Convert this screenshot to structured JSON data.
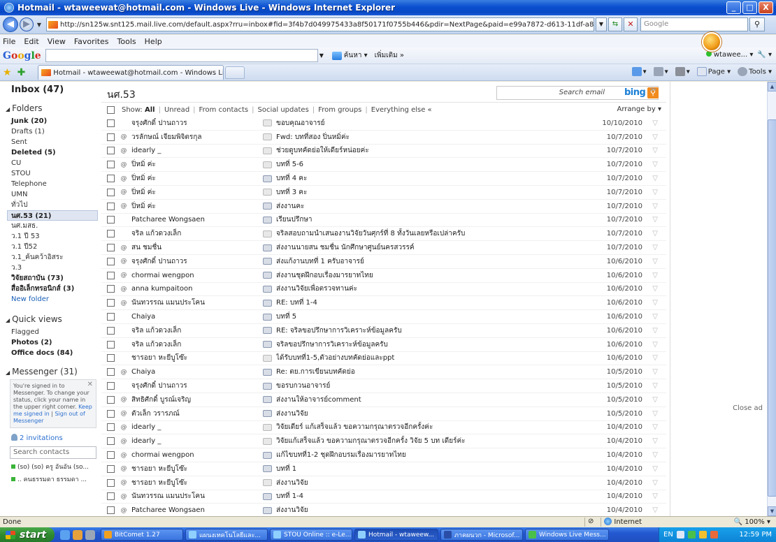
{
  "window": {
    "title": "Hotmail - wtaweewat@hotmail.com - Windows Live - Windows Internet Explorer",
    "buttons": {
      "minimize": "_",
      "maximize": "□",
      "close": "X"
    }
  },
  "address_bar": {
    "url": "http://sn125w.snt125.mail.live.com/default.aspx?rru=inbox#fid=3f4b7d049975433a8f50171f0755b446&pdir=NextPage&paid=e99a7872-d613-11df-a803-001e0bcbbd80&pad=",
    "search_placeholder": "Google"
  },
  "menu": [
    "File",
    "Edit",
    "View",
    "Favorites",
    "Tools",
    "Help"
  ],
  "google_toolbar": {
    "logo": [
      "G",
      "o",
      "o",
      "g",
      "l",
      "e"
    ],
    "search_label": "ค้นหา",
    "more_label": "เพิ่มเติม »",
    "user_label": "wtawee..."
  },
  "tab": {
    "label": "Hotmail - wtaweewat@hotmail.com - Windows Live"
  },
  "command_bar": {
    "page": "Page",
    "tools": "Tools"
  },
  "sidebar": {
    "inbox": "Inbox (47)",
    "folders_label": "Folders",
    "folders": [
      {
        "label": "Junk (20)",
        "bold": true
      },
      {
        "label": "Drafts (1)",
        "bold": false
      },
      {
        "label": "Sent",
        "bold": false
      },
      {
        "label": "Deleted (5)",
        "bold": true
      },
      {
        "label": "CU",
        "bold": false
      },
      {
        "label": "STOU",
        "bold": false
      },
      {
        "label": "Telephone",
        "bold": false
      },
      {
        "label": "UMN",
        "bold": false
      },
      {
        "label": "ทั่วไป",
        "bold": false
      },
      {
        "label": "นศ.53 (21)",
        "bold": true,
        "selected": true
      },
      {
        "label": "นศ.มสธ.",
        "bold": false
      },
      {
        "label": "ว.1 ปี 53",
        "bold": false
      },
      {
        "label": "ว.1 ปี52",
        "bold": false
      },
      {
        "label": "ว.1_ค้นคว้าอิสระ",
        "bold": false
      },
      {
        "label": "ว.3",
        "bold": false
      },
      {
        "label": "วิจัยสถาบัน (73)",
        "bold": true
      },
      {
        "label": "สื่ออิเล็กทรอนิกส์ (3)",
        "bold": true
      }
    ],
    "new_folder": "New folder",
    "quick_views_label": "Quick views",
    "quick_views": [
      {
        "label": "Flagged",
        "bold": false
      },
      {
        "label": "Photos (2)",
        "bold": true
      },
      {
        "label": "Office docs (84)",
        "bold": true
      }
    ],
    "messenger_label": "Messenger (31)",
    "messenger_note": "You're signed in to Messenger. To change your status, click your name in the upper right corner.",
    "messenger_link1": "Keep me signed in",
    "messenger_sep": "|",
    "messenger_link2": "Sign out of Messenger",
    "invitations": "2 invitations",
    "search_contacts": "Search contacts",
    "contacts": [
      "(so) (so) ครู อันอัน (so...",
      ".. คนธรรมดา ธรรมดา ..."
    ]
  },
  "list": {
    "folder_title": "นศ.53",
    "search_placeholder": "Search email",
    "bing_label": "bing",
    "filter": {
      "show": "Show:",
      "all": "All",
      "items": [
        "Unread",
        "From contacts",
        "Social updates",
        "From groups",
        "Everything else «"
      ],
      "arrange": "Arrange by ▾"
    },
    "messages": [
      {
        "at": "",
        "from": "จรุงศักดิ์ ปานถาวร",
        "subject": "ขอบคุณอาจารย์",
        "date": "10/10/2010",
        "read": false
      },
      {
        "at": "@",
        "from": "วรลักษณ์ เจียมพิจิตรกุล",
        "subject": "Fwd: บทที่สอง ปิ่นหมิ่ค่ะ",
        "date": "10/7/2010",
        "read": false
      },
      {
        "at": "@",
        "from": "idearly _",
        "subject": "ช่วยดูบทคัดย่อให้เดียร์หน่อยค่ะ",
        "date": "10/7/2010",
        "read": false
      },
      {
        "at": "@",
        "from": "ปิ่หมิ่ ค่ะ",
        "subject": "บทที่ 5-6",
        "date": "10/7/2010",
        "read": false
      },
      {
        "at": "@",
        "from": "ปิ่หมิ่ ค่ะ",
        "subject": "บทที่ 4 คะ",
        "date": "10/7/2010",
        "read": true
      },
      {
        "at": "@",
        "from": "ปิ่หมิ่ ค่ะ",
        "subject": "บทที่ 3 คะ",
        "date": "10/7/2010",
        "read": false
      },
      {
        "at": "@",
        "from": "ปิ่หมิ่ ค่ะ",
        "subject": "ส่งงานคะ",
        "date": "10/7/2010",
        "read": true
      },
      {
        "at": "",
        "from": "Patcharee Wongsaen",
        "subject": "เรียนปรึกษา",
        "date": "10/7/2010",
        "read": true
      },
      {
        "at": "",
        "from": "จริล แก้วดวงเล็ก",
        "subject": "จริลสอบถามนำเสนองานวิจัยวันศุกร์ที่ 8 ทั้งวันเลยหรือเปล่าครับ",
        "date": "10/7/2010",
        "read": false
      },
      {
        "at": "@",
        "from": "สน ชมชื่น",
        "subject": "ส่งงานนายสน ชมชื่น นักศึกษาศูนย์นครสวรรค์",
        "date": "10/7/2010",
        "read": true
      },
      {
        "at": "@",
        "from": "จรุงศักดิ์ ปานถาวร",
        "subject": "ส่งแก้งานบทที่ 1 ครับอาจารย์",
        "date": "10/6/2010",
        "read": true
      },
      {
        "at": "@",
        "from": "chormai wengpon",
        "subject": "ส่งงานชุดฝึกอบเรื่องมารยาทไทย",
        "date": "10/6/2010",
        "read": true
      },
      {
        "at": "@",
        "from": "anna kumpaitoon",
        "subject": "ส่งงานวิจัยเพื่อตรวจทานค่ะ",
        "date": "10/6/2010",
        "read": true
      },
      {
        "at": "@",
        "from": "นันทวรรณ แมนประโคน",
        "subject": "RE: บทที่ 1-4",
        "date": "10/6/2010",
        "read": true
      },
      {
        "at": "",
        "from": "Chaiya",
        "subject": "บทที่ 5",
        "date": "10/6/2010",
        "read": true
      },
      {
        "at": "",
        "from": "จริล แก้วดวงเล็ก",
        "subject": "RE: จริลขอปรึกษาการวิเคราะห์ข้อมูลครับ",
        "date": "10/6/2010",
        "read": true
      },
      {
        "at": "",
        "from": "จริล แก้วดวงเล็ก",
        "subject": "จริลขอปรึกษาการวิเคราะห์ข้อมูลครับ",
        "date": "10/6/2010",
        "read": true
      },
      {
        "at": "",
        "from": "ชารอยา หะยีบูโซ๊ะ",
        "subject": "ได้รับบทที่1-5,ตัวอย่างบทคัดย่อและppt",
        "date": "10/6/2010",
        "read": false
      },
      {
        "at": "@",
        "from": "Chaiya",
        "subject": "Re: ตย.การเขียนบทคัดย่อ",
        "date": "10/5/2010",
        "read": true
      },
      {
        "at": "",
        "from": "จรุงศักดิ์ ปานถาวร",
        "subject": "ขอรบกวนอาจารย์",
        "date": "10/5/2010",
        "read": true
      },
      {
        "at": "@",
        "from": "สิทธิศักดิ์ บูรณ์เจริญ",
        "subject": "ส่งงานให้อาจารย์comment",
        "date": "10/5/2010",
        "read": true
      },
      {
        "at": "@",
        "from": "ตัวเล็ก วรารภณ์",
        "subject": "ส่งงานวิจัย",
        "date": "10/5/2010",
        "read": true
      },
      {
        "at": "@",
        "from": "idearly _",
        "subject": "วิจัยเดียร์ แก้เสร็จแล้ว ขอความกรุณาตรวจอีกครั้งค่ะ",
        "date": "10/4/2010",
        "read": false
      },
      {
        "at": "@",
        "from": "idearly _",
        "subject": "วิจัยแก้เสร็จแล้ว ขอความกรุณาตรวจอีกครั้ง วิจัย 5 บท เดียร์ค่ะ",
        "date": "10/4/2010",
        "read": false
      },
      {
        "at": "@",
        "from": "chormai wengpon",
        "subject": "แก้ไขบทที่1-2 ชุดฝึกอบรมเรื่องมารยาทไทย",
        "date": "10/4/2010",
        "read": true
      },
      {
        "at": "@",
        "from": "ชารอยา หะยีบูโซ๊ะ",
        "subject": "บทที่ 1",
        "date": "10/4/2010",
        "read": true
      },
      {
        "at": "@",
        "from": "ชารอยา หะยีบูโซ๊ะ",
        "subject": "ส่งงานวิจัย",
        "date": "10/4/2010",
        "read": false
      },
      {
        "at": "@",
        "from": "นันทวรรณ แมนประโคน",
        "subject": "บทที่ 1-4",
        "date": "10/4/2010",
        "read": true
      },
      {
        "at": "@",
        "from": "Patcharee Wongsaen",
        "subject": "ส่งงานวิจัย",
        "date": "10/4/2010",
        "read": true
      }
    ]
  },
  "ad": {
    "close": "Close ad"
  },
  "status": {
    "left": "Done",
    "zone": "Internet",
    "zoom": "100%"
  },
  "taskbar": {
    "start": "start",
    "tasks": [
      "BitComet 1.27",
      "แผนงเทคโนโลยีและ...",
      "STOU Online :: e-Le...",
      "Hotmail - wtaweew...",
      "ภาคผนวก - Microsof...",
      "Windows Live Mess..."
    ],
    "lang": "EN",
    "clock": "12:59 PM"
  },
  "colors": {
    "accent": "#2a6fd0",
    "title_bar": "#0a4fd0",
    "taskbar": "#2458d0",
    "start": "#2f8a2f"
  }
}
